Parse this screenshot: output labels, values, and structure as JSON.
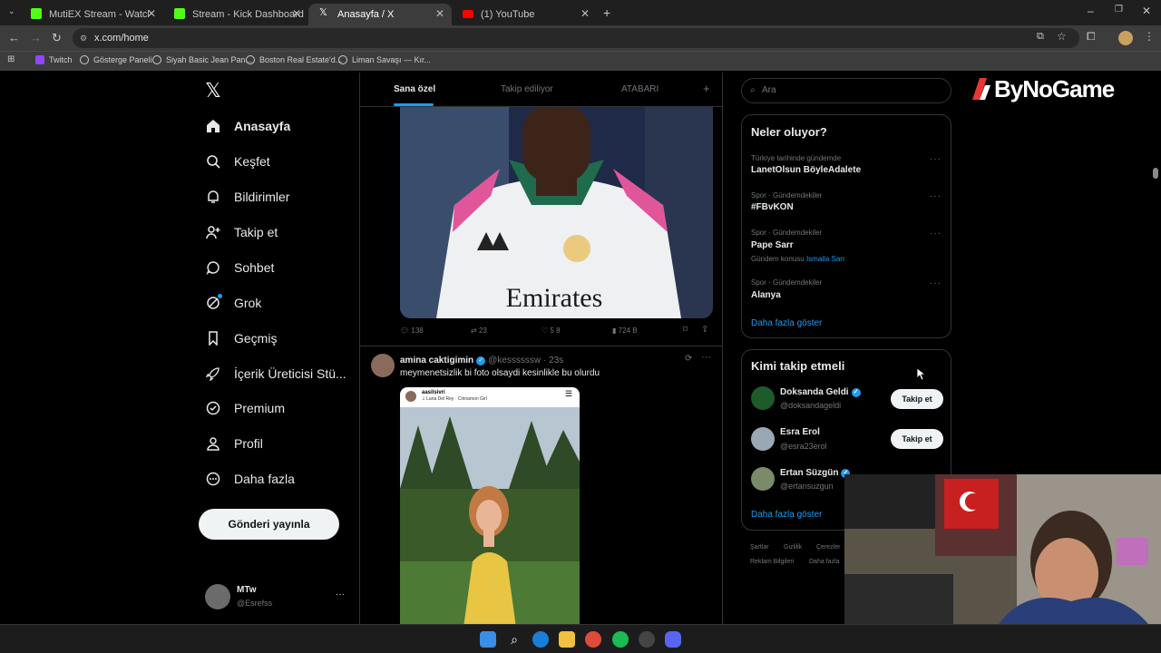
{
  "browser": {
    "tabs": [
      {
        "title": "MutiEX Stream - Watch Live on",
        "fav_color": "#53fc18"
      },
      {
        "title": "Stream - Kick Dashboard",
        "fav_color": "#53fc18"
      },
      {
        "title": "Anasayfa / X",
        "fav_color": "#ffffff"
      },
      {
        "title": "(1) YouTube",
        "fav_color": "#ff0000"
      }
    ],
    "url": "x.com/home",
    "bookmarks": [
      "Twitch",
      "Gösterge Paneli",
      "Siyah Basic Jean Pan...",
      "Boston Real Estate'd...",
      "Liman Savaşı — Kır..."
    ]
  },
  "nav": {
    "logo": "𝕏",
    "items": [
      {
        "label": "Anasayfa",
        "icon": "home-icon"
      },
      {
        "label": "Keşfet",
        "icon": "search-icon"
      },
      {
        "label": "Bildirimler",
        "icon": "bell-icon"
      },
      {
        "label": "Takip et",
        "icon": "person-plus-icon"
      },
      {
        "label": "Sohbet",
        "icon": "chat-icon"
      },
      {
        "label": "Grok",
        "icon": "grok-icon"
      },
      {
        "label": "Geçmiş",
        "icon": "bookmark-icon"
      },
      {
        "label": "İçerik Üreticisi Stü...",
        "icon": "rocket-icon"
      },
      {
        "label": "Premium",
        "icon": "verified-icon"
      },
      {
        "label": "Profil",
        "icon": "person-icon"
      },
      {
        "label": "Daha fazla",
        "icon": "more-circle-icon"
      }
    ],
    "post_button": "Gönderi yayınla",
    "account": {
      "name": "MTw",
      "handle": "@Esrefss",
      "more": "···"
    }
  },
  "feed": {
    "tabs": [
      "Sana özel",
      "Takip ediliyor",
      "ATABARI"
    ],
    "add_tab": "+",
    "tweet1": {
      "jersey_text": "Emirates",
      "stats": {
        "replies": "138",
        "retweets": "23",
        "likes": "5 8",
        "views": "724 B"
      }
    },
    "tweet2": {
      "author": "amina caktigimin",
      "handle": "@kessssssw",
      "time": "· 23s",
      "text": "meymenetsizlik bi foto olsaydi kesinlikle bu olurdu",
      "embed_author": "aasilsivri",
      "embed_subtitle": "♫ Lana Del Rey · Cinnamon Girl"
    }
  },
  "right": {
    "search_placeholder": "Ara",
    "brand": "ByNoGame",
    "trends_title": "Neler oluyor?",
    "trends": [
      {
        "meta": "Türkiye tarihinde gündemde",
        "name": "LanetOlsun BöyleAdalete"
      },
      {
        "meta": "Spor · Gündemdekiler",
        "name": "#FBvKON"
      },
      {
        "meta": "Spor · Gündemdekiler",
        "name": "Pape Sarr",
        "extra_label": "Gündem konusu",
        "extra_link": "Ismaila Sarr"
      },
      {
        "meta": "Spor · Gündemdekiler",
        "name": "Alanya"
      }
    ],
    "trend_more": "···",
    "show_more": "Daha fazla göster",
    "wtf_title": "Kimi takip etmeli",
    "wtf": [
      {
        "name": "Doksanda Geldi",
        "handle": "@doksandageldi",
        "verified": true
      },
      {
        "name": "Esra Erol",
        "handle": "@esra23erol",
        "verified": false
      },
      {
        "name": "Ertan Süzgün",
        "handle": "@ertansuzgun",
        "verified": true
      }
    ],
    "follow_label": "Takip et",
    "footer": [
      "Şartlar",
      "Gizlilik",
      "Çerezler",
      "Reklam Bilgileri",
      "Daha fazla"
    ]
  },
  "colors": {
    "accent": "#1d9bf0",
    "bg": "#000000",
    "border": "#2f3336",
    "muted": "#71767b"
  }
}
